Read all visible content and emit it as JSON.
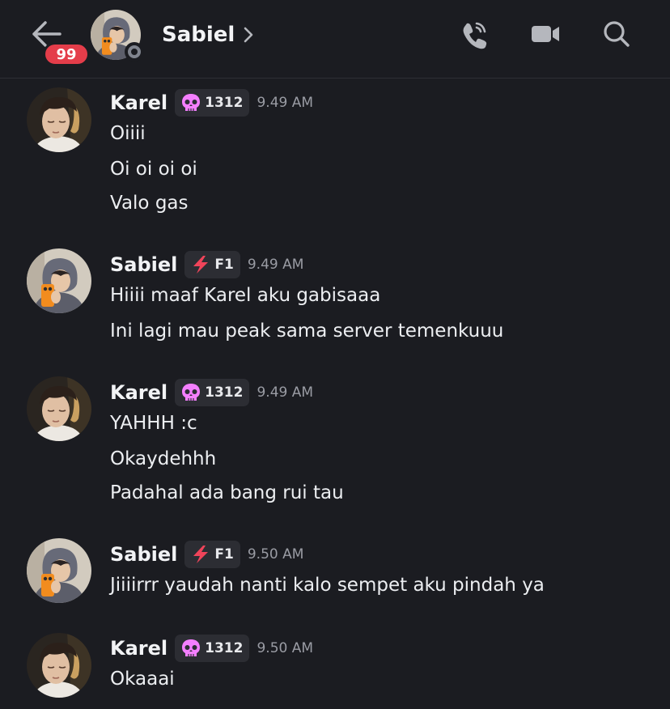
{
  "header": {
    "unread_count": "99",
    "channel_name": "Sabiel"
  },
  "messages": [
    {
      "author": "Karel",
      "tag": "1312",
      "tag_icon": "skull-icon",
      "time": "9.49 AM",
      "lines": [
        "Oiiii",
        "Oi oi oi oi",
        "Valo gas"
      ]
    },
    {
      "author": "Sabiel",
      "tag": "F1",
      "tag_icon": "lightning-icon",
      "time": "9.49 AM",
      "lines": [
        "Hiiii maaf Karel aku gabisaaa",
        "Ini lagi mau peak sama server temenkuuu"
      ]
    },
    {
      "author": "Karel",
      "tag": "1312",
      "tag_icon": "skull-icon",
      "time": "9.49 AM",
      "lines": [
        "YAHHH :c",
        "Okaydehhh",
        "Padahal ada bang rui tau"
      ]
    },
    {
      "author": "Sabiel",
      "tag": "F1",
      "tag_icon": "lightning-icon",
      "time": "9.50 AM",
      "lines": [
        "Jiiiirrr yaudah nanti kalo sempet aku pindah ya"
      ]
    },
    {
      "author": "Karel",
      "tag": "1312",
      "tag_icon": "skull-icon",
      "time": "9.50 AM",
      "lines": [
        "Okaaai"
      ]
    }
  ],
  "colors": {
    "background": "#1b1c21",
    "badge_red": "#e43d4a",
    "tag_background": "#2c2d33",
    "skull_pink": "#f47fff",
    "lightning_red": "#f0445a",
    "timestamp_gray": "#9a9ca4"
  }
}
